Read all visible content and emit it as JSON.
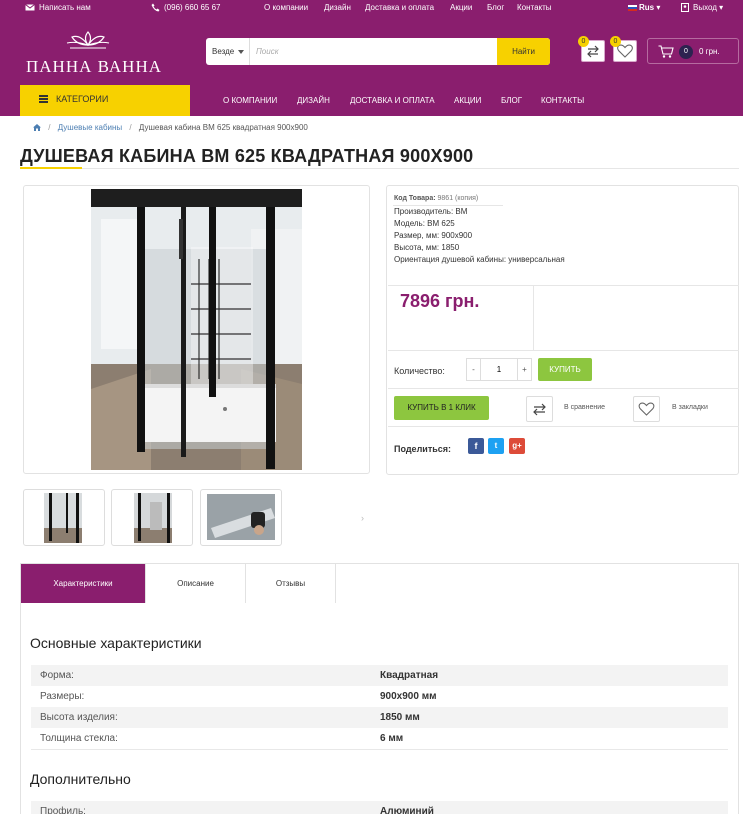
{
  "topbar": {
    "write_us": "Написать нам",
    "phone": "(096) 660 65 67",
    "links": [
      "О компании",
      "Дизайн",
      "Доставка и оплата",
      "Акции",
      "Блог",
      "Контакты"
    ],
    "language": "Rus",
    "logout": "Выход"
  },
  "header": {
    "logo_text": "ПАННА ВАННА",
    "search_scope": "Везде",
    "search_placeholder": "Поиск",
    "search_button": "Найти",
    "compare_count": "0",
    "wishlist_count": "0",
    "cart_count": "0",
    "cart_total": "0 грн."
  },
  "nav": {
    "categories_label": "КАТЕГОРИИ",
    "items": [
      "О КОМПАНИИ",
      "ДИЗАЙН",
      "ДОСТАВКА И ОПЛАТА",
      "АКЦИИ",
      "БЛОГ",
      "КОНТАКТЫ"
    ]
  },
  "breadcrumb": {
    "items": [
      "Душевые кабины",
      "Душевая кабина BM 625 квадратная 900x900"
    ]
  },
  "product": {
    "title": "ДУШЕВАЯ КАБИНА BM 625 КВАДРАТНАЯ 900X900",
    "code_label": "Код Товара:",
    "code_value": "9861 (копия)",
    "attributes": [
      "Производитель: BM",
      "Модель: BM 625",
      "Размер, мм: 900x900",
      "Высота, мм: 1850",
      "Ориентация душевой кабины: универсальная"
    ],
    "price": "7896 грн.",
    "quantity_label": "Количество:",
    "quantity_value": "1",
    "minus": "-",
    "plus": "+",
    "buy_label": "КУПИТЬ",
    "one_click_label": "КУПИТЬ В 1 КЛИК",
    "compare_label": "В сравнение",
    "wishlist_label": "В закладки",
    "share_label": "Поделиться:",
    "social": [
      "f",
      "t",
      "g+"
    ]
  },
  "gallery": {
    "prev": "‹",
    "next": "›"
  },
  "tabs": [
    "Характеристики",
    "Описание",
    "Отзывы"
  ],
  "specs": {
    "main_title": "Основные характеристики",
    "main_rows": [
      {
        "k": "Форма:",
        "v": "Квадратная"
      },
      {
        "k": "Размеры:",
        "v": "900x900 мм"
      },
      {
        "k": "Высота изделия:",
        "v": "1850 мм"
      },
      {
        "k": "Толщина стекла:",
        "v": "6 мм"
      }
    ],
    "extra_title": "Дополнительно",
    "extra_rows": [
      {
        "k": "Профиль:",
        "v": "Алюминий"
      }
    ]
  },
  "colors": {
    "brand": "#8a1e6e",
    "accent": "#f7d100",
    "buy": "#8dc63f"
  }
}
